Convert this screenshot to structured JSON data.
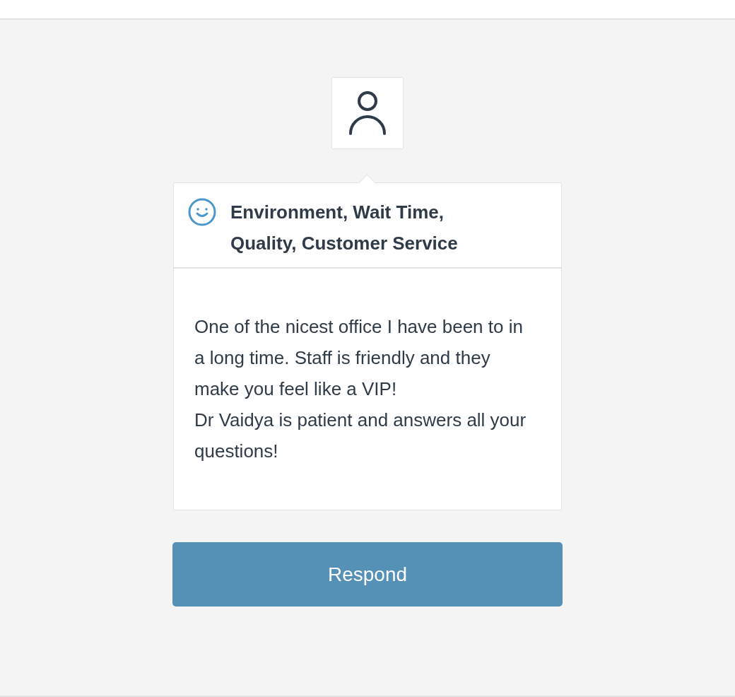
{
  "review": {
    "categories": "Environment, Wait Time, Quality, Customer Service",
    "kind": "smiley",
    "paragraphs": [
      "One of the nicest office I have been to in a long time. Staff is friendly and they make you feel like a VIP!",
      "Dr Vaidya is patient and answers all your questions!"
    ]
  },
  "respond_button": {
    "label": "Respond"
  }
}
